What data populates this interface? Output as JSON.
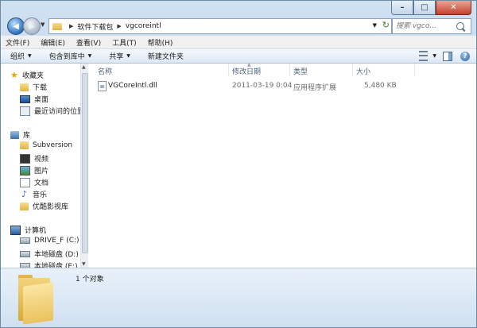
{
  "window": {
    "caption_buttons": {
      "minimize": "–",
      "maximize": "□",
      "close": "✕"
    }
  },
  "address": {
    "crumbs": [
      "软件下载包",
      "vgcoreintl"
    ],
    "search_placeholder": "搜索 vgco..."
  },
  "menu": [
    "文件(F)",
    "编辑(E)",
    "查看(V)",
    "工具(T)",
    "帮助(H)"
  ],
  "toolbar": {
    "organize": "组织",
    "include_library": "包含到库中",
    "share": "共享",
    "new_folder": "新建文件夹"
  },
  "sidebar": {
    "favorites": {
      "label": "收藏夹",
      "items": [
        "下载",
        "桌面",
        "最近访问的位置"
      ]
    },
    "libraries": {
      "label": "库",
      "items": [
        "Subversion",
        "视频",
        "图片",
        "文档",
        "音乐",
        "优酷影视库"
      ]
    },
    "computer": {
      "label": "计算机",
      "items": [
        "DRIVE_F (C:)",
        "本地磁盘 (D:)",
        "本地磁盘 (E:)"
      ]
    }
  },
  "columns": [
    "名称",
    "修改日期",
    "类型",
    "大小"
  ],
  "files": [
    {
      "name": "VGCoreIntl.dll",
      "modified": "2011-03-19 0:04",
      "type": "应用程序扩展",
      "size": "5,480 KB"
    }
  ],
  "details": {
    "count": "1 个对象"
  },
  "colors": {
    "accent": "#3d6fa8",
    "frame": "#b9d1ea",
    "folder": "#e9c25c"
  }
}
